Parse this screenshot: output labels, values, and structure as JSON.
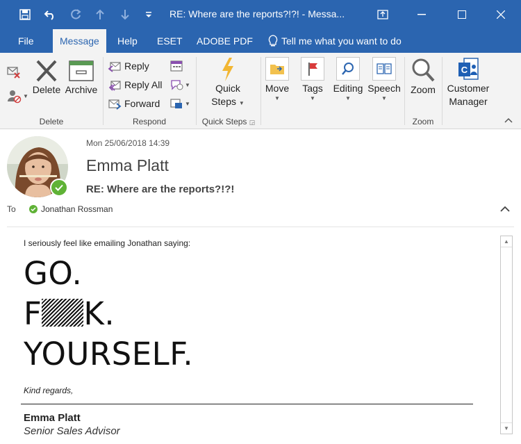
{
  "window": {
    "title": "RE: Where are the reports?!?!  -  Messa...",
    "colors": {
      "accent": "#2b65b0",
      "presence": "#5fb236"
    }
  },
  "tabs": [
    "File",
    "Message",
    "Help",
    "ESET",
    "ADOBE PDF"
  ],
  "active_tab": "Message",
  "tell_me": "Tell me what you want to do",
  "ribbon": {
    "delete_group": {
      "delete": "Delete",
      "archive": "Archive",
      "label": "Delete"
    },
    "respond_group": {
      "reply": "Reply",
      "reply_all": "Reply All",
      "forward": "Forward",
      "label": "Respond"
    },
    "quick_steps_group": {
      "line1": "Quick",
      "line2": "Steps",
      "label": "Quick Steps"
    },
    "move": "Move",
    "tags": "Tags",
    "editing": "Editing",
    "speech": "Speech",
    "zoom_group": {
      "zoom": "Zoom",
      "label": "Zoom"
    },
    "customer_manager": {
      "line1": "Customer",
      "line2": "Manager"
    }
  },
  "message": {
    "datetime": "Mon 25/06/2018 14:39",
    "sender": "Emma Platt",
    "subject": "RE: Where are the reports?!?!",
    "to_label": "To",
    "recipient": "Jonathan Rossman"
  },
  "body": {
    "intro": "I seriously feel like emailing Jonathan saying:",
    "line1": "GO.",
    "line2_start": "F",
    "line2_end": "K.",
    "line3": "YOURSELF.",
    "regards": "Kind regards,",
    "signature_name": "Emma Platt",
    "signature_role": "Senior Sales Advisor"
  }
}
